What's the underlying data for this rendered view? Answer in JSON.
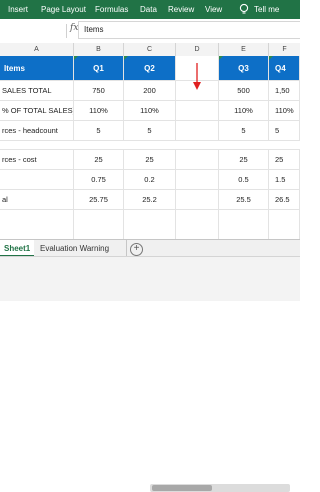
{
  "ribbon": {
    "tabs": [
      "Insert",
      "Page Layout",
      "Formulas",
      "Data",
      "Review",
      "View"
    ],
    "tell_me": "Tell me",
    "color": "#217346"
  },
  "formula_bar": {
    "fx": "fx",
    "value": "Items"
  },
  "columns": [
    "A",
    "B",
    "C",
    "D",
    "E",
    "F"
  ],
  "table": {
    "header": {
      "items": "Items",
      "q1": "Q1",
      "q2": "Q2",
      "q3": "Q3",
      "q4": "Q4"
    },
    "rows": [
      {
        "label": "SALES TOTAL",
        "q1": "750",
        "q2": "200",
        "q3": "500",
        "q4": "1,50"
      },
      {
        "label": "% OF TOTAL SALES)",
        "q1": "110%",
        "q2": "110%",
        "q3": "110%",
        "q4": "110%"
      },
      {
        "label": "rces - headcount",
        "q1": "5",
        "q2": "5",
        "q3": "5",
        "q4": "5"
      },
      {
        "label": "rces - cost",
        "q1": "25",
        "q2": "25",
        "q3": "25",
        "q4": "25"
      },
      {
        "label": "",
        "q1": "0.75",
        "q2": "0.2",
        "q3": "0.5",
        "q4": "1.5"
      },
      {
        "label": "al",
        "q1": "25.75",
        "q2": "25.2",
        "q3": "25.5",
        "q4": "26.5"
      }
    ]
  },
  "sheet_tabs": {
    "active": "Sheet1",
    "other": "Evaluation Warning",
    "add": "+"
  },
  "colors": {
    "header_blue": "#0d6fc7",
    "arrow_red": "#e02020"
  }
}
